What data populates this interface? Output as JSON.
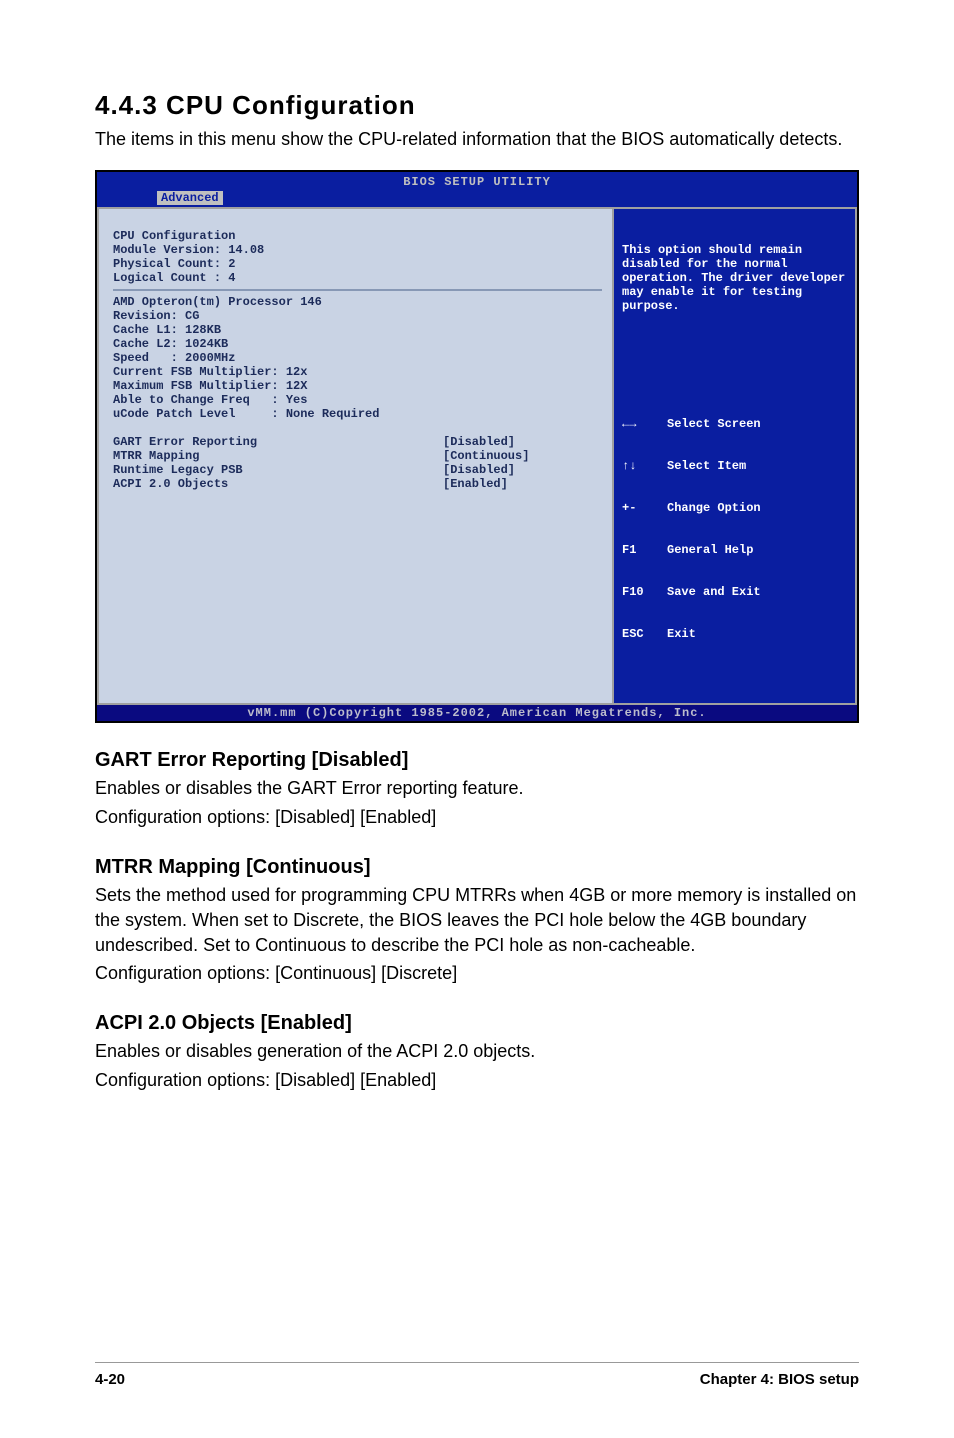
{
  "section": {
    "number_title": "4.4.3   CPU Configuration",
    "intro": "The items in this menu show the CPU-related information that the BIOS automatically detects."
  },
  "bios": {
    "title": "BIOS SETUP UTILITY",
    "tab": "Advanced",
    "left": {
      "header": [
        "CPU Configuration",
        "Module Version: 14.08",
        "Physical Count: 2",
        "Logical Count : 4"
      ],
      "info": [
        "AMD Opteron(tm) Processor 146",
        "Revision: CG",
        "Cache L1: 128KB",
        "Cache L2: 1024KB",
        "Speed   : 2000MHz",
        "Current FSB Multiplier: 12x",
        "Maximum FSB Multiplier: 12X",
        "Able to Change Freq   : Yes",
        "uCode Patch Level     : None Required"
      ],
      "settings": [
        {
          "label": "GART Error Reporting",
          "value": "[Disabled]"
        },
        {
          "label": "MTRR Mapping",
          "value": "[Continuous]"
        },
        {
          "label": "Runtime Legacy PSB",
          "value": "[Disabled]"
        },
        {
          "label": "ACPI 2.0 Objects",
          "value": "[Enabled]"
        }
      ]
    },
    "right": {
      "help": "This option should remain disabled for the normal operation. The driver developer may enable it for testing purpose.",
      "nav": [
        {
          "key": "←→",
          "desc": "Select Screen"
        },
        {
          "key": "↑↓",
          "desc": "Select Item"
        },
        {
          "key": "+-",
          "desc": "Change Option"
        },
        {
          "key": "F1",
          "desc": "General Help"
        },
        {
          "key": "F10",
          "desc": "Save and Exit"
        },
        {
          "key": "ESC",
          "desc": "Exit"
        }
      ]
    },
    "footer": "vMM.mm (C)Copyright 1985-2002, American Megatrends, Inc."
  },
  "sections": {
    "gart": {
      "title": "GART Error Reporting [Disabled]",
      "l1": "Enables or disables the GART Error reporting feature.",
      "l2": "Configuration options: [Disabled] [Enabled]"
    },
    "mtrr": {
      "title": "MTRR Mapping [Continuous]",
      "l1": "Sets the method used for programming CPU MTRRs when 4GB or more memory is installed on the system. When set to Discrete, the BIOS leaves the PCI hole below the 4GB boundary undescribed. Set to Continuous to describe the PCI hole as non-cacheable.",
      "l2": "Configuration options: [Continuous] [Discrete]"
    },
    "acpi": {
      "title": "ACPI 2.0 Objects [Enabled]",
      "l1": "Enables or disables generation of the ACPI 2.0 objects.",
      "l2": "Configuration options: [Disabled] [Enabled]"
    }
  },
  "footer": {
    "left": "4-20",
    "right": "Chapter 4: BIOS setup"
  }
}
